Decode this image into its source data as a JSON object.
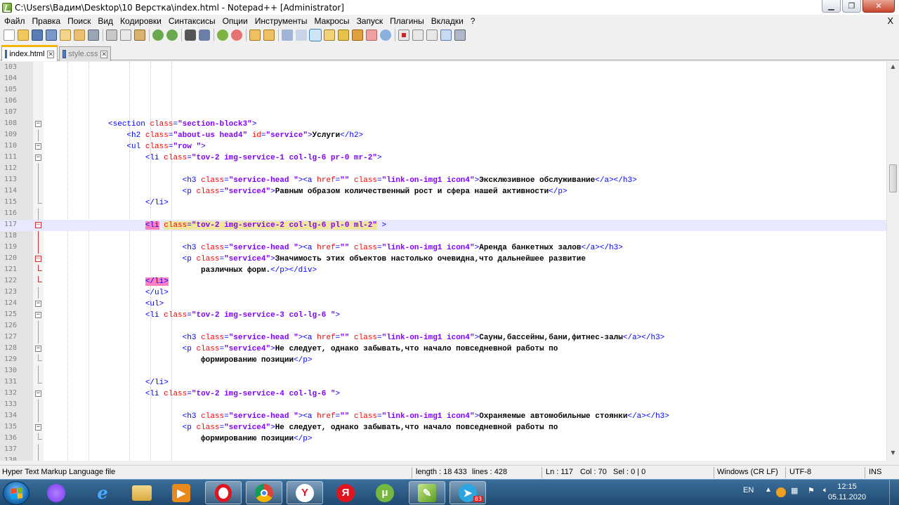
{
  "window": {
    "title": "C:\\Users\\Вадим\\Desktop\\10 Верстка\\index.html - Notepad++ [Administrator]",
    "min_glyph": "▁",
    "max_glyph": "❐",
    "close_glyph": "✕"
  },
  "menu": {
    "items": [
      "Файл",
      "Правка",
      "Поиск",
      "Вид",
      "Кодировки",
      "Синтаксисы",
      "Опции",
      "Инструменты",
      "Макросы",
      "Запуск",
      "Плагины",
      "Вкладки",
      "?"
    ],
    "close_glyph": "X"
  },
  "tabs": [
    {
      "label": "index.html",
      "close": "✕"
    },
    {
      "label": "style.css",
      "close": "✕"
    }
  ],
  "editor": {
    "lines": [
      {
        "n": "103",
        "html": ""
      },
      {
        "n": "104",
        "html": ""
      },
      {
        "n": "105",
        "html": ""
      },
      {
        "n": "106",
        "html": ""
      },
      {
        "n": "107",
        "html": ""
      },
      {
        "n": "108",
        "html": "<span class='t'>&lt;section</span> <span class='a'>class</span><span class='t'>=</span><span class='v'>\"section-block3\"</span><span class='t'>&gt;</span>"
      },
      {
        "n": "109",
        "html": "    <span class='t'>&lt;h2</span> <span class='a'>class</span><span class='t'>=</span><span class='v'>\"about-us head4\"</span> <span class='a'>id</span><span class='t'>=</span><span class='v'>\"service\"</span><span class='t'>&gt;</span><span class='x'>Услуги</span><span class='t'>&lt;/h2&gt;</span>"
      },
      {
        "n": "110",
        "html": "    <span class='t'>&lt;ul</span> <span class='a'>class</span><span class='t'>=</span><span class='v'>\"row \"</span><span class='t'>&gt;</span>"
      },
      {
        "n": "111",
        "html": "        <span class='t'>&lt;li</span> <span class='a'>class</span><span class='t'>=</span><span class='v'>\"tov-2 img-service-1 col-lg-6 pr-0 mr-2\"</span><span class='t'>&gt;</span>"
      },
      {
        "n": "112",
        "html": ""
      },
      {
        "n": "113",
        "html": "                <span class='t'>&lt;h3</span> <span class='a'>class</span><span class='t'>=</span><span class='v'>\"service-head \"</span><span class='t'>&gt;&lt;a</span> <span class='a'>href</span><span class='t'>=</span><span class='v'>\"\"</span> <span class='a'>class</span><span class='t'>=</span><span class='v'>\"link-on-img1 icon4\"</span><span class='t'>&gt;</span><span class='x'>Эксклюзивное обслуживание</span><span class='t'>&lt;/a&gt;&lt;/h3&gt;</span>"
      },
      {
        "n": "114",
        "html": "                <span class='t'>&lt;p</span> <span class='a'>class</span><span class='t'>=</span><span class='v'>\"service4\"</span><span class='t'>&gt;</span><span class='x'>Равным образом количественный рост и сфера нашей активности</span><span class='t'>&lt;/p&gt;</span>"
      },
      {
        "n": "115",
        "html": "        <span class='t'>&lt;/li&gt;</span>"
      },
      {
        "n": "116",
        "html": ""
      },
      {
        "n": "117",
        "html": "        <span class='t hl'>&lt;li</span> <span class='a hly'>class</span><span class='t hly'>=</span><span class='v hly'>\"tov-2 img-service-2 col-lg-6 pl-0 ml-2\"</span> <span class='t'>&gt;</span>"
      },
      {
        "n": "118",
        "html": ""
      },
      {
        "n": "119",
        "html": "                <span class='t'>&lt;h3</span> <span class='a'>class</span><span class='t'>=</span><span class='v'>\"service-head \"</span><span class='t'>&gt;&lt;a</span> <span class='a'>href</span><span class='t'>=</span><span class='v'>\"\"</span> <span class='a'>class</span><span class='t'>=</span><span class='v'>\"link-on-img1 icon4\"</span><span class='t'>&gt;</span><span class='x'>Аренда банкетных залов</span><span class='t'>&lt;/a&gt;&lt;/h3&gt;</span>"
      },
      {
        "n": "120",
        "html": "                <span class='t'>&lt;p</span> <span class='a'>class</span><span class='t'>=</span><span class='v'>\"service4\"</span><span class='t'>&gt;</span><span class='x'>Значимость этих объектов настолько очевидна,что дальнейшее развитие</span>"
      },
      {
        "n": "121",
        "html": "                    <span class='x'>различных форм.</span><span class='t'>&lt;/p&gt;&lt;/div&gt;</span>"
      },
      {
        "n": "122",
        "html": "        <span class='t hl'>&lt;/li&gt;</span>"
      },
      {
        "n": "123",
        "html": "        <span class='t'>&lt;/ul&gt;</span>"
      },
      {
        "n": "124",
        "html": "        <span class='t'>&lt;ul&gt;</span>"
      },
      {
        "n": "125",
        "html": "        <span class='t'>&lt;li</span> <span class='a'>class</span><span class='t'>=</span><span class='v'>\"tov-2 img-service-3 col-lg-6 \"</span><span class='t'>&gt;</span>"
      },
      {
        "n": "126",
        "html": ""
      },
      {
        "n": "127",
        "html": "                <span class='t'>&lt;h3</span> <span class='a'>class</span><span class='t'>=</span><span class='v'>\"service-head \"</span><span class='t'>&gt;&lt;a</span> <span class='a'>href</span><span class='t'>=</span><span class='v'>\"\"</span> <span class='a'>class</span><span class='t'>=</span><span class='v'>\"link-on-img1 icon4\"</span><span class='t'>&gt;</span><span class='x'>Сауны,бассейны,бани,фитнес-залы</span><span class='t'>&lt;/a&gt;&lt;/h3&gt;</span>"
      },
      {
        "n": "128",
        "html": "                <span class='t'>&lt;p</span> <span class='a'>class</span><span class='t'>=</span><span class='v'>\"service4\"</span><span class='t'>&gt;</span><span class='x'>Не следует, однако забывать,что начало повседневной работы по</span>"
      },
      {
        "n": "129",
        "html": "                    <span class='x'>формированию позиции</span><span class='t'>&lt;/p&gt;</span>"
      },
      {
        "n": "130",
        "html": ""
      },
      {
        "n": "131",
        "html": "        <span class='t'>&lt;/li&gt;</span>"
      },
      {
        "n": "132",
        "html": "        <span class='t'>&lt;li</span> <span class='a'>class</span><span class='t'>=</span><span class='v'>\"tov-2 img-service-4 col-lg-6 \"</span><span class='t'>&gt;</span>"
      },
      {
        "n": "133",
        "html": ""
      },
      {
        "n": "134",
        "html": "                <span class='t'>&lt;h3</span> <span class='a'>class</span><span class='t'>=</span><span class='v'>\"service-head \"</span><span class='t'>&gt;&lt;a</span> <span class='a'>href</span><span class='t'>=</span><span class='v'>\"\"</span> <span class='a'>class</span><span class='t'>=</span><span class='v'>\"link-on-img1 icon4\"</span><span class='t'>&gt;</span><span class='x'>Охраняемые автомобильные стоянки</span><span class='t'>&lt;/a&gt;&lt;/h3&gt;</span>"
      },
      {
        "n": "135",
        "html": "                <span class='t'>&lt;p</span> <span class='a'>class</span><span class='t'>=</span><span class='v'>\"service4\"</span><span class='t'>&gt;</span><span class='x'>Не следует, однако забывать,что начало повседневной работы по</span>"
      },
      {
        "n": "136",
        "html": "                    <span class='x'>формированию позиции</span><span class='t'>&lt;/p&gt;</span>"
      },
      {
        "n": "137",
        "html": ""
      },
      {
        "n": "138",
        "html": ""
      }
    ]
  },
  "status": {
    "language": "Hyper Text Markup Language file",
    "length": "length : 18 433",
    "lines": "lines : 428",
    "ln": "Ln : 117",
    "col": "Col : 70",
    "sel": "Sel : 0 | 0",
    "eol": "Windows (CR LF)",
    "encoding": "UTF-8",
    "mode": "INS"
  },
  "taskbar": {
    "lang": "EN",
    "time": "12:15",
    "date": "05.11.2020",
    "telegram_badge": "83",
    "yandex_letter": "Я",
    "yandex_browser_letter": "Y"
  },
  "colors": {
    "tag": "#0000ff",
    "attribute": "#ff0000",
    "value": "#8000ff",
    "current_line": "#e8e8ff",
    "tab_accent": "#f7b500"
  }
}
